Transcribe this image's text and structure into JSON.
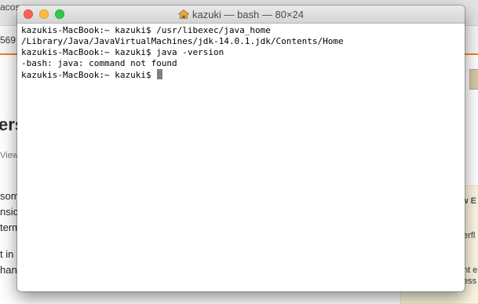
{
  "background": {
    "tab_fragment": "acos",
    "url_fragment": "569",
    "heading_fragment": "ers",
    "view_fragment": "View",
    "paragraph1": [
      "som",
      "nsic",
      "term"
    ],
    "paragraph2": [
      "t in",
      "hank"
    ],
    "right_panel_heading": "w E",
    "right_panel_lines": [
      "erfl",
      "nt e",
      "ess"
    ]
  },
  "terminal": {
    "title": "kazuki — bash — 80×24",
    "lines": [
      "kazukis-MacBook:~ kazuki$ /usr/libexec/java_home",
      "/Library/Java/JavaVirtualMachines/jdk-14.0.1.jdk/Contents/Home",
      "kazukis-MacBook:~ kazuki$ java -version",
      "-bash: java: command not found"
    ],
    "prompt": "kazukis-MacBook:~ kazuki$ "
  }
}
